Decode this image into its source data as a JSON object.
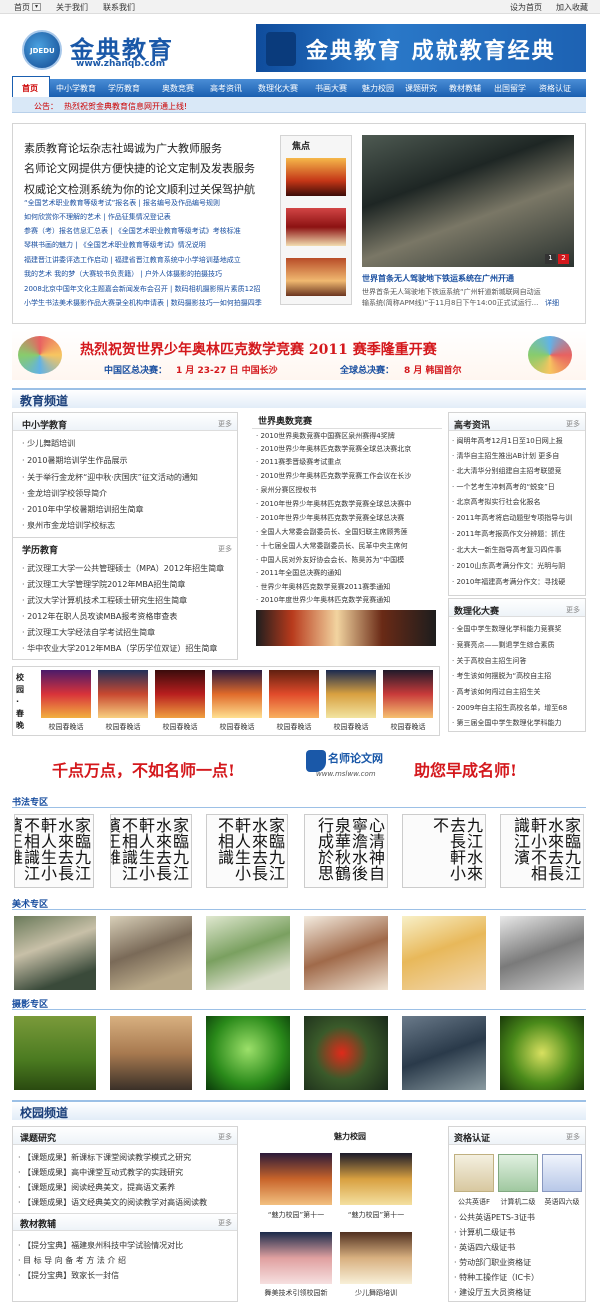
{
  "topbar": {
    "home": "首页",
    "about": "关于我们",
    "contact": "联系我们",
    "set_home": "设为首页",
    "favorite": "加入收藏"
  },
  "header": {
    "logo_text": "金典教育",
    "logo_url": "www.zhanqb.com",
    "banner_text": "金典教育  成就教育经典"
  },
  "nav": {
    "home": "首页",
    "items": [
      "中小学教育",
      "学历教育",
      "奥数竞赛",
      "高考资讯",
      "数理化大赛",
      "书画大赛",
      "魅力校园",
      "课题研究",
      "教材教辅",
      "出国留学",
      "资格认证"
    ]
  },
  "subnav": {
    "label": "公告：",
    "text": "热烈祝贺金典教育信息网开通上线!"
  },
  "headlines": {
    "big": [
      "素质教育论坛杂志社竭诚为广大教师服务",
      "名师论文网提供方便快捷的论文定制及发表服务",
      "权威论文检测系统为你的论文顺利过关保驾护航"
    ],
    "small": [
      "“全国艺术职业教育等级考试”报名表 | 报名编号及作品编号规则",
      "如何欣赏你不理解的艺术 | 作品征集情况登记表",
      "参赛（考）报名信息汇总表 | 《全国艺术职业教育等级考试》考核标准",
      "琴棋书画的魅力 | 《全国艺术职业教育等级考试》情况说明",
      "福建晋江讲委评选工作启动 | 福建省晋江教育系统中小学培训基地成立",
      "我的艺术 我的梦（大赛较书负责籍） | 户外人体摄影的拍摄技巧",
      "2008北京中国年文化主题嘉会新闻发布会召开 | 数码相机摄影照片素质12招",
      "小学生书法美术摄影作品大赛录全机构申请表 | 数码摄影技巧一如何拍摄四季"
    ]
  },
  "focus": {
    "title": "焦点"
  },
  "slide": {
    "title": "世界首条无人驾驶地下铁运系统在广州开通",
    "desc": "世界首条无人驾驶地下铁运系统“广州轩道新城联网自动运输系统(简称APM线)”于11月8日下午14:00正式试运行...",
    "more": "详细",
    "pages": [
      "1",
      "2"
    ]
  },
  "olympiad_banner": {
    "title": "热烈祝贺世界少年奥林匹克数学竞赛 2011 赛季隆重开赛",
    "china_label": "中国区总决赛：",
    "china_detail": "1 月 23-27 日  中国长沙",
    "global_label": "全球总决赛：",
    "global_detail": "8 月    韩国首尔"
  },
  "edu_section": {
    "title": "教育频道"
  },
  "primary": {
    "title": "中小学教育",
    "more": "更多",
    "items": [
      "少儿舞蹈培训",
      "2010暑期培训学生作品展示",
      "关于举行金龙杯“迎中秋·庆国庆”征文活动的通知",
      "金龙培训学校领导简介",
      "2010年中学校暑期培训招生简章",
      "泉州市金龙培训学校标志"
    ]
  },
  "academic": {
    "title": "学历教育",
    "more": "更多",
    "items": [
      "武汉理工大学一公共管理硕士（MPA）2012年招生简章",
      "武汉理工大学管理学院2012年MBA招生简章",
      "武汉大学计算机技术工程硕士研究生招生简章",
      "2012年在职人员攻读MBA报考资格审查表",
      "武汉理工大学经法自学考试招生简章",
      "华中农业大学2012年MBA（学历学位双证）招生简章"
    ]
  },
  "olympiad": {
    "title": "世界奥数竞赛",
    "items": [
      "2010世界奥数竞赛中国赛区泉州赛得4奖牌",
      "2010世界少年奥林匹克数学竞赛全球总决赛北京",
      "2011赛季晋级赛考试重点",
      "2010世界少年奥林匹克数学竞赛工作会议在长沙",
      "泉州分赛区授权书",
      "2010年世界少年奥林匹克数学竞赛全球总决赛中",
      "2010年世界少年奥林匹克数学竞赛全球总决赛",
      "全国人大常委会副委员长、全国妇联主席顾秀莲",
      "十七届全国人大常委副委员长、民革中央主席何",
      "中国人民对外友好协会会长、陈昊苏为“中国模",
      "2011年全国总决赛的通知",
      "世界少年奥林匹克数学竞赛2011赛季通知",
      "2010年度世界少年奥林匹克数学竞赛通知"
    ]
  },
  "gaokao": {
    "title": "高考资讯",
    "more": "更多",
    "items": [
      "闽明年高考12月1日至10日网上报",
      "清华自主招生推出AB计划 更多自",
      "北大清华分别组建自主招考联盟竞",
      "一个艺考生冲刺高考的“蜕变”日",
      "北京高考拟实行社会化报名",
      "2011年高考将启动题型专项指导与训",
      "2011年高考报高作文分辨题：抓住",
      "北大大一新生指导高考复习四件事",
      "2010山东高考满分作文：光明与阴",
      "2010年福建高考满分作文：寻找硬"
    ]
  },
  "science": {
    "title": "数理化大赛",
    "more": "更多",
    "items": [
      "全国中学生数理化学科能力竞赛奖",
      "竞赛亮点——剩退学生综合素质",
      "关于高校自主招生问答",
      "考生该如何摆脱为“高校自主招",
      "高考该如何闯过自主招生关",
      "2009年自主招生高校名单，增至68",
      "第三届全国中学生数理化学科能力"
    ]
  },
  "campus_strip": {
    "label": "校园·春晚",
    "captions": [
      "校园春晚话",
      "校园春晚话",
      "校园春晚话",
      "校园春晚话",
      "校园春晚话",
      "校园春晚话",
      "校园春晚话"
    ]
  },
  "ad": {
    "left": "千点万点，不如名师一点!",
    "brand": "名师论文网",
    "url": "www.mslww.com",
    "right": "助您早成名师!"
  },
  "calligraphy": {
    "title": "书法专区",
    "works": [
      "家臨九江水來去長軒人生小不相識江濱王維",
      "家臨九江水來去長軒人生小不相識江濱王維",
      "家臨九江水來去長軒人生小不相識",
      "心清神自寧澹水後泉華秋鶴行成於思",
      "九江水來去長軒小不",
      "家臨九江水來去長軒小不相識江濱",
      "家臨九江水來去長軒人生小不相識江濱",
      "家臨九江水來去長軒人生小不相識江濱"
    ]
  },
  "art": {
    "title": "美术专区"
  },
  "photo": {
    "title": "摄影专区"
  },
  "campus_section": {
    "title": "校园频道"
  },
  "research": {
    "title": "课题研究",
    "more": "更多",
    "items": [
      "【课题成果】新课标下课堂阅读教学模式之研究",
      "【课题成果】高中课堂互动式教学的实践研究",
      "【课题成果】阅读经典美文，提高语文素养",
      "【课题成果】语文经典美文的阅读教学对高语阅读教"
    ]
  },
  "textbook": {
    "title": "教材教辅",
    "more": "更多",
    "items": [
      "【提分宝典】福建泉州科技中学试验情况对比",
      "目 标 导 向 备 考 方 法 介 绍",
      "【提分宝典】致家长一封信"
    ]
  },
  "charm": {
    "title": "魅力校园",
    "captions": [
      "“魅力校园”第十一",
      "“魅力校园”第十一",
      "舞美技术引领校园新",
      "少儿舞蹈培训"
    ]
  },
  "cert": {
    "title": "资格认证",
    "more": "更多",
    "captions": [
      "公共英语F",
      "计算机二级",
      "英语四六级"
    ],
    "items": [
      "公共英语PETS-3证书",
      "计算机二级证书",
      "英语四六级证书",
      "劳动部门职业资格证",
      "特种工操作证（IC卡）",
      "建设厅五大员资格证"
    ]
  },
  "colors": {
    "brand_blue": "#1a58a8",
    "nav_blue": "#2a6fc0",
    "accent_red": "#d4181c",
    "link_blue": "#1a4fa0"
  }
}
